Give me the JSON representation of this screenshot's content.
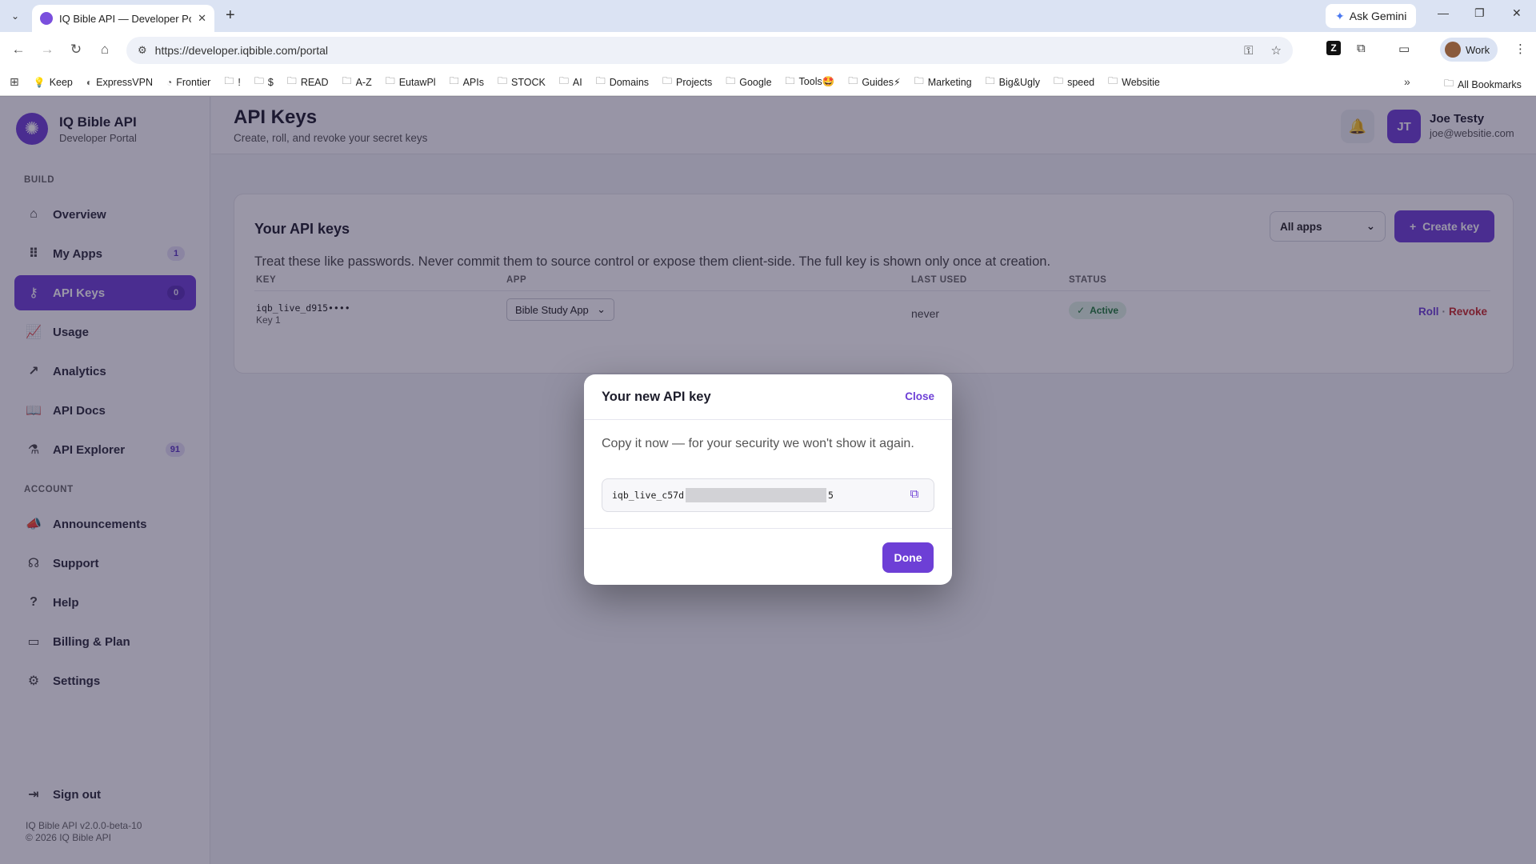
{
  "browser": {
    "tab_title": "IQ Bible API — Developer Portal",
    "url": "https://developer.iqbible.com/portal",
    "gemini_label": "Ask Gemini",
    "profile_label": "Work",
    "bookmarks": [
      {
        "label": "Keep",
        "icon": "keep-icon"
      },
      {
        "label": "ExpressVPN",
        "icon": "expressvpn-icon"
      },
      {
        "label": "Frontier",
        "icon": "frontier-icon"
      },
      {
        "label": "!",
        "icon": "folder-icon"
      },
      {
        "label": "$",
        "icon": "folder-icon"
      },
      {
        "label": "READ",
        "icon": "folder-icon"
      },
      {
        "label": "A-Z",
        "icon": "folder-icon"
      },
      {
        "label": "EutawPl",
        "icon": "folder-icon"
      },
      {
        "label": "APIs",
        "icon": "folder-icon"
      },
      {
        "label": "STOCK",
        "icon": "folder-icon"
      },
      {
        "label": "AI",
        "icon": "folder-icon"
      },
      {
        "label": "Domains",
        "icon": "folder-icon"
      },
      {
        "label": "Projects",
        "icon": "folder-icon"
      },
      {
        "label": "Google",
        "icon": "folder-icon"
      },
      {
        "label": "Tools🤩",
        "icon": "folder-icon"
      },
      {
        "label": "Guides⚡",
        "icon": "folder-icon"
      },
      {
        "label": "Marketing",
        "icon": "folder-icon"
      },
      {
        "label": "Big&Ugly",
        "icon": "folder-icon"
      },
      {
        "label": "speed",
        "icon": "folder-icon"
      },
      {
        "label": "Websitie",
        "icon": "folder-icon"
      }
    ],
    "all_bookmarks_label": "All Bookmarks"
  },
  "sidebar": {
    "brand_name": "IQ Bible API",
    "brand_sub": "Developer Portal",
    "build_label": "BUILD",
    "account_label": "ACCOUNT",
    "build_items": [
      {
        "label": "Overview",
        "icon": "home-icon",
        "badge": ""
      },
      {
        "label": "My Apps",
        "icon": "grid-icon",
        "badge": "1"
      },
      {
        "label": "API Keys",
        "icon": "key-icon",
        "badge": "0"
      },
      {
        "label": "Usage",
        "icon": "usage-chart-icon",
        "badge": ""
      },
      {
        "label": "Analytics",
        "icon": "analytics-icon",
        "badge": ""
      },
      {
        "label": "API Docs",
        "icon": "book-icon",
        "badge": ""
      },
      {
        "label": "API Explorer",
        "icon": "flask-icon",
        "badge": "91"
      }
    ],
    "account_items": [
      {
        "label": "Announcements",
        "icon": "megaphone-icon"
      },
      {
        "label": "Support",
        "icon": "support-icon"
      },
      {
        "label": "Help",
        "icon": "help-icon"
      },
      {
        "label": "Billing & Plan",
        "icon": "card-icon"
      },
      {
        "label": "Settings",
        "icon": "gear-icon"
      }
    ],
    "sign_out": "Sign out",
    "version": "IQ Bible API v2.0.0-beta-10",
    "copyright": "© 2026 IQ Bible API"
  },
  "header": {
    "title": "API Keys",
    "subtitle": "Create, roll, and revoke your secret keys",
    "user_initials": "JT",
    "user_name": "Joe Testy",
    "user_email": "joe@websitie.com"
  },
  "keys_card": {
    "title": "Your API keys",
    "filter_value": "All apps",
    "create_label": "Create key",
    "note": "Treat these like passwords. Never commit them to source control or expose them client-side. The full key is shown only once at creation.",
    "columns": [
      "KEY",
      "APP",
      "LAST USED",
      "STATUS"
    ],
    "rows": [
      {
        "key": "iqb_live_d915••••",
        "name": "Key 1",
        "app": "Bible Study App",
        "last_used": "never",
        "status": "Active",
        "roll": "Roll",
        "sep": "·",
        "revoke": "Revoke"
      }
    ]
  },
  "modal": {
    "title": "Your new API key",
    "close_label": "Close",
    "message": "Copy it now — for your security we won't show it again.",
    "key_prefix": "iqb_live_c57d",
    "key_suffix": "5",
    "done_label": "Done"
  },
  "colors": {
    "accent": "#6d3fd6",
    "danger": "#c62828",
    "success": "#1f7a3a"
  }
}
